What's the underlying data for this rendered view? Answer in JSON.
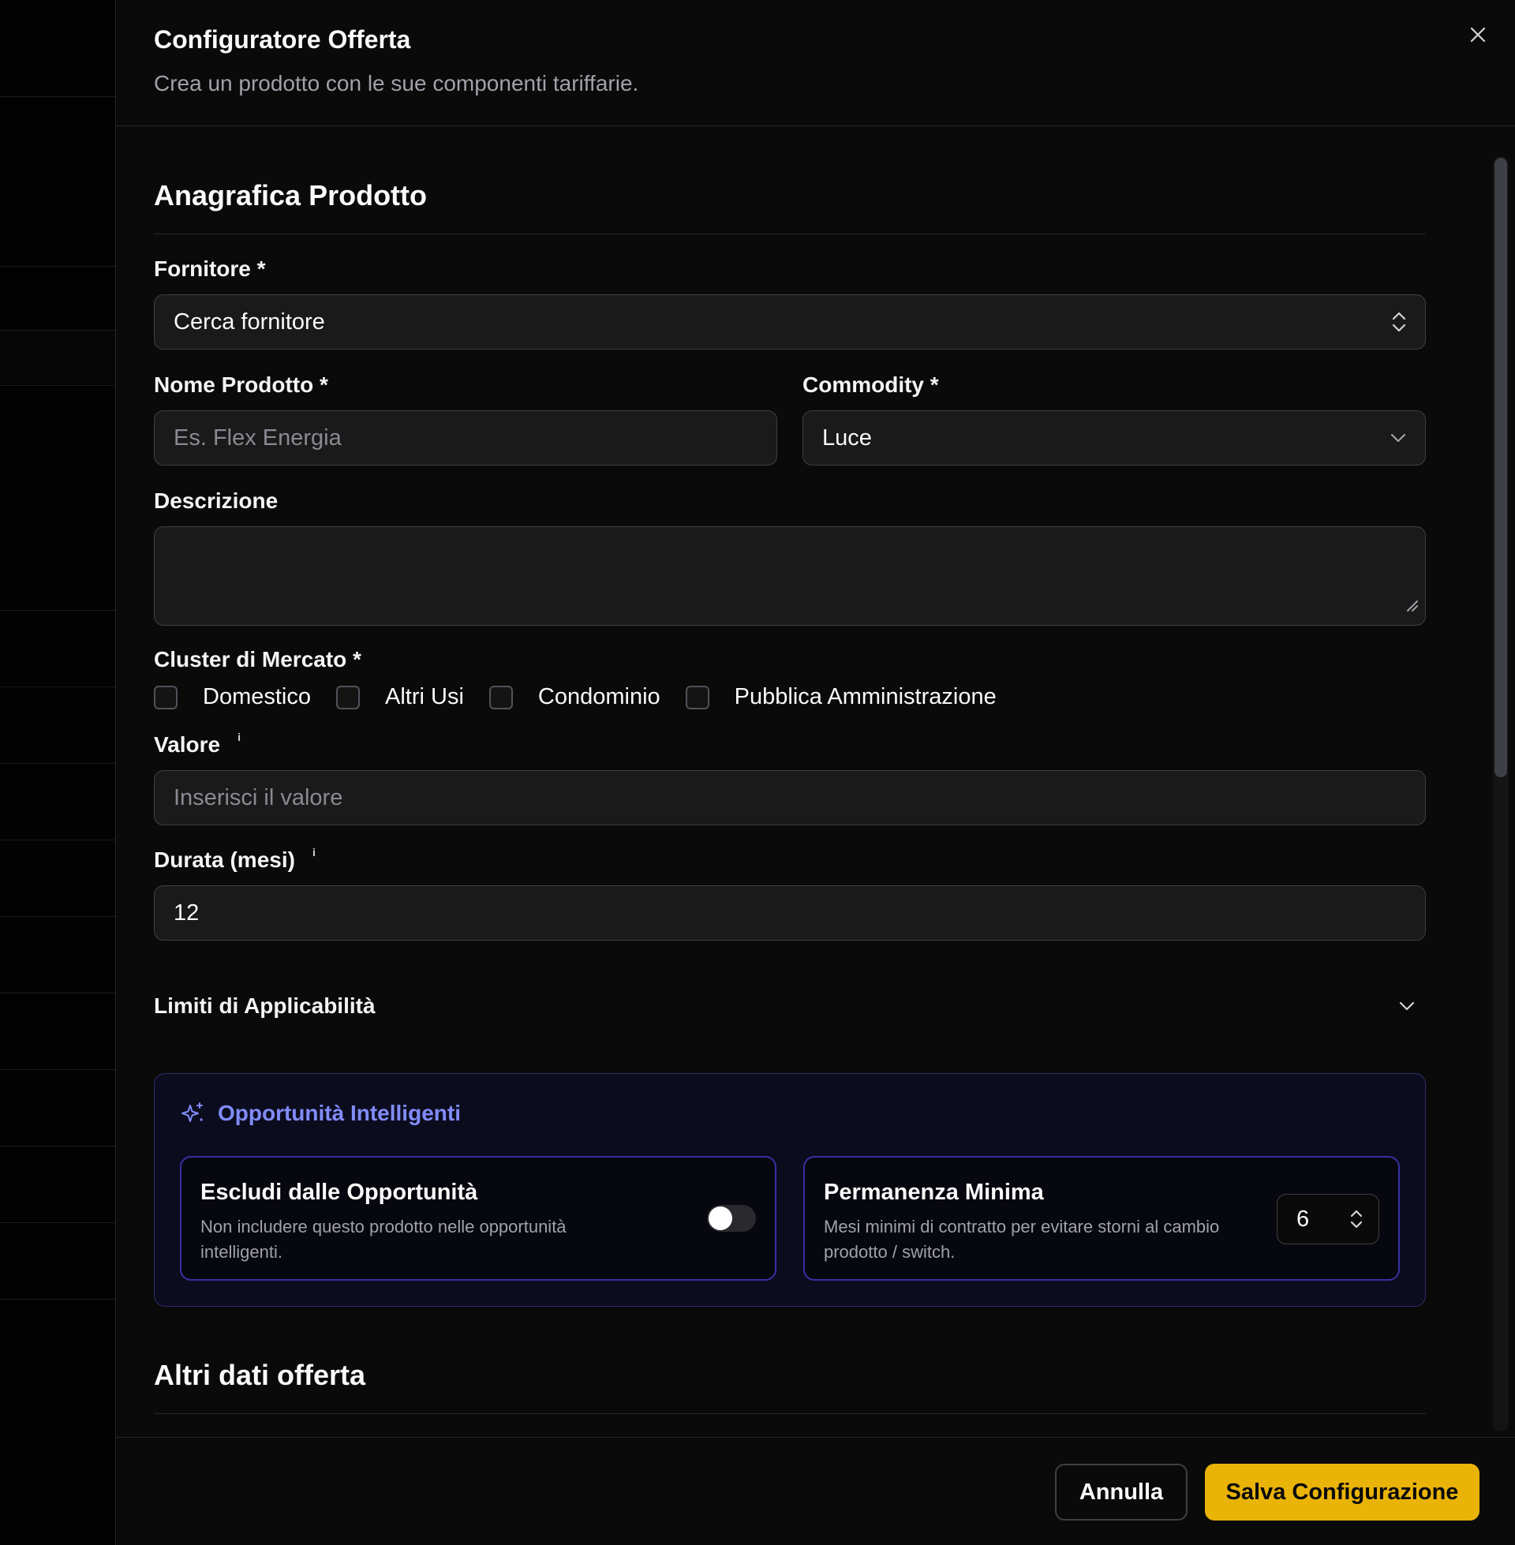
{
  "dialog": {
    "title": "Configuratore Offerta",
    "subtitle": "Crea un prodotto con le sue componenti tariffarie."
  },
  "section_product": {
    "title": "Anagrafica Prodotto",
    "supplier": {
      "label": "Fornitore *",
      "value": "Cerca fornitore"
    },
    "product_name": {
      "label": "Nome Prodotto *",
      "placeholder": "Es. Flex Energia"
    },
    "commodity": {
      "label": "Commodity *",
      "value": "Luce"
    },
    "description": {
      "label": "Descrizione",
      "value": ""
    },
    "cluster": {
      "label": "Cluster di Mercato *",
      "options": [
        {
          "label": "Domestico",
          "checked": false
        },
        {
          "label": "Altri Usi",
          "checked": false
        },
        {
          "label": "Condominio",
          "checked": false
        },
        {
          "label": "Pubblica Amministrazione",
          "checked": false
        }
      ]
    },
    "value": {
      "label": "Valore",
      "info": "i",
      "placeholder": "Inserisci il valore"
    },
    "duration": {
      "label": "Durata (mesi)",
      "info": "i",
      "value": "12"
    },
    "limits": {
      "label": "Limiti di Applicabilità",
      "expanded": false
    }
  },
  "smart_opportunities": {
    "title": "Opportunità Intelligenti",
    "accent": "#818cf8",
    "exclude": {
      "title": "Escludi dalle Opportunità",
      "description": "Non includere questo prodotto nelle opportunità intelligenti.",
      "enabled": false
    },
    "min_permanence": {
      "title": "Permanenza Minima",
      "description": "Mesi minimi di contratto per evitare storni al cambio prodotto / switch.",
      "value": "6"
    }
  },
  "section_other": {
    "title": "Altri dati offerta"
  },
  "footer": {
    "cancel_label": "Annulla",
    "save_label": "Salva Configurazione",
    "save_color": "#eab308"
  },
  "icons": {
    "close": "close-icon",
    "supplier_trail": "chevron-up-down-icon",
    "commodity_trail": "chevron-down-icon",
    "limits_trail": "chevron-down-icon",
    "smart": "sparkles-icon",
    "stepper": "chevron-up-down-icon"
  }
}
